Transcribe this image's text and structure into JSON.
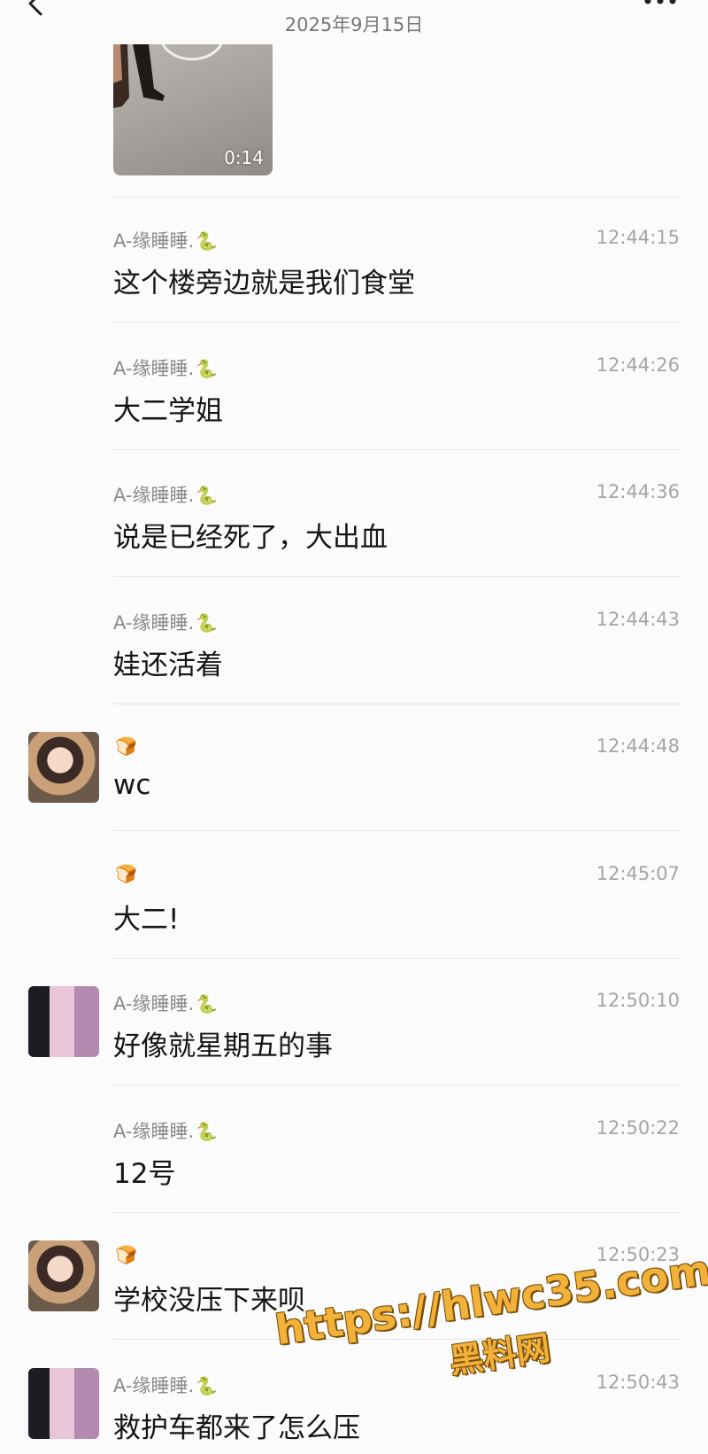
{
  "header": {
    "title": "",
    "date": "2025年9月15日",
    "back_icon": "chevron-left-icon",
    "more_icon": "more-dots-icon"
  },
  "video": {
    "duration": "0:14"
  },
  "messages": [
    {
      "sender": "A-缘睡睡.",
      "sender_emoji": "🐍",
      "time": "12:44:15",
      "text": "这个楼旁边就是我们食堂",
      "avatar": ""
    },
    {
      "sender": "A-缘睡睡.",
      "sender_emoji": "🐍",
      "time": "12:44:26",
      "text": "大二学姐",
      "avatar": ""
    },
    {
      "sender": "A-缘睡睡.",
      "sender_emoji": "🐍",
      "time": "12:44:36",
      "text": "说是已经死了，大出血",
      "avatar": ""
    },
    {
      "sender": "A-缘睡睡.",
      "sender_emoji": "🐍",
      "time": "12:44:43",
      "text": "娃还活着",
      "avatar": ""
    },
    {
      "sender": "",
      "sender_emoji": "🍞",
      "time": "12:44:48",
      "text": "wc",
      "avatar": "girl-avatar"
    },
    {
      "sender": "",
      "sender_emoji": "🍞",
      "time": "12:45:07",
      "text": "大二!",
      "avatar": ""
    },
    {
      "sender": "A-缘睡睡.",
      "sender_emoji": "🐍",
      "time": "12:50:10",
      "text": "好像就星期五的事",
      "avatar": "anime-avatar"
    },
    {
      "sender": "A-缘睡睡.",
      "sender_emoji": "🐍",
      "time": "12:50:22",
      "text": "12号",
      "avatar": ""
    },
    {
      "sender": "",
      "sender_emoji": "🍞",
      "time": "12:50:23",
      "text": "学校没压下来呗",
      "avatar": "girl-avatar"
    },
    {
      "sender": "A-缘睡睡.",
      "sender_emoji": "🐍",
      "time": "12:50:43",
      "text": "救护车都来了怎么压",
      "avatar": "anime-avatar"
    }
  ],
  "watermark": {
    "url": "https://hlwc35.com",
    "name": "黑料网"
  }
}
